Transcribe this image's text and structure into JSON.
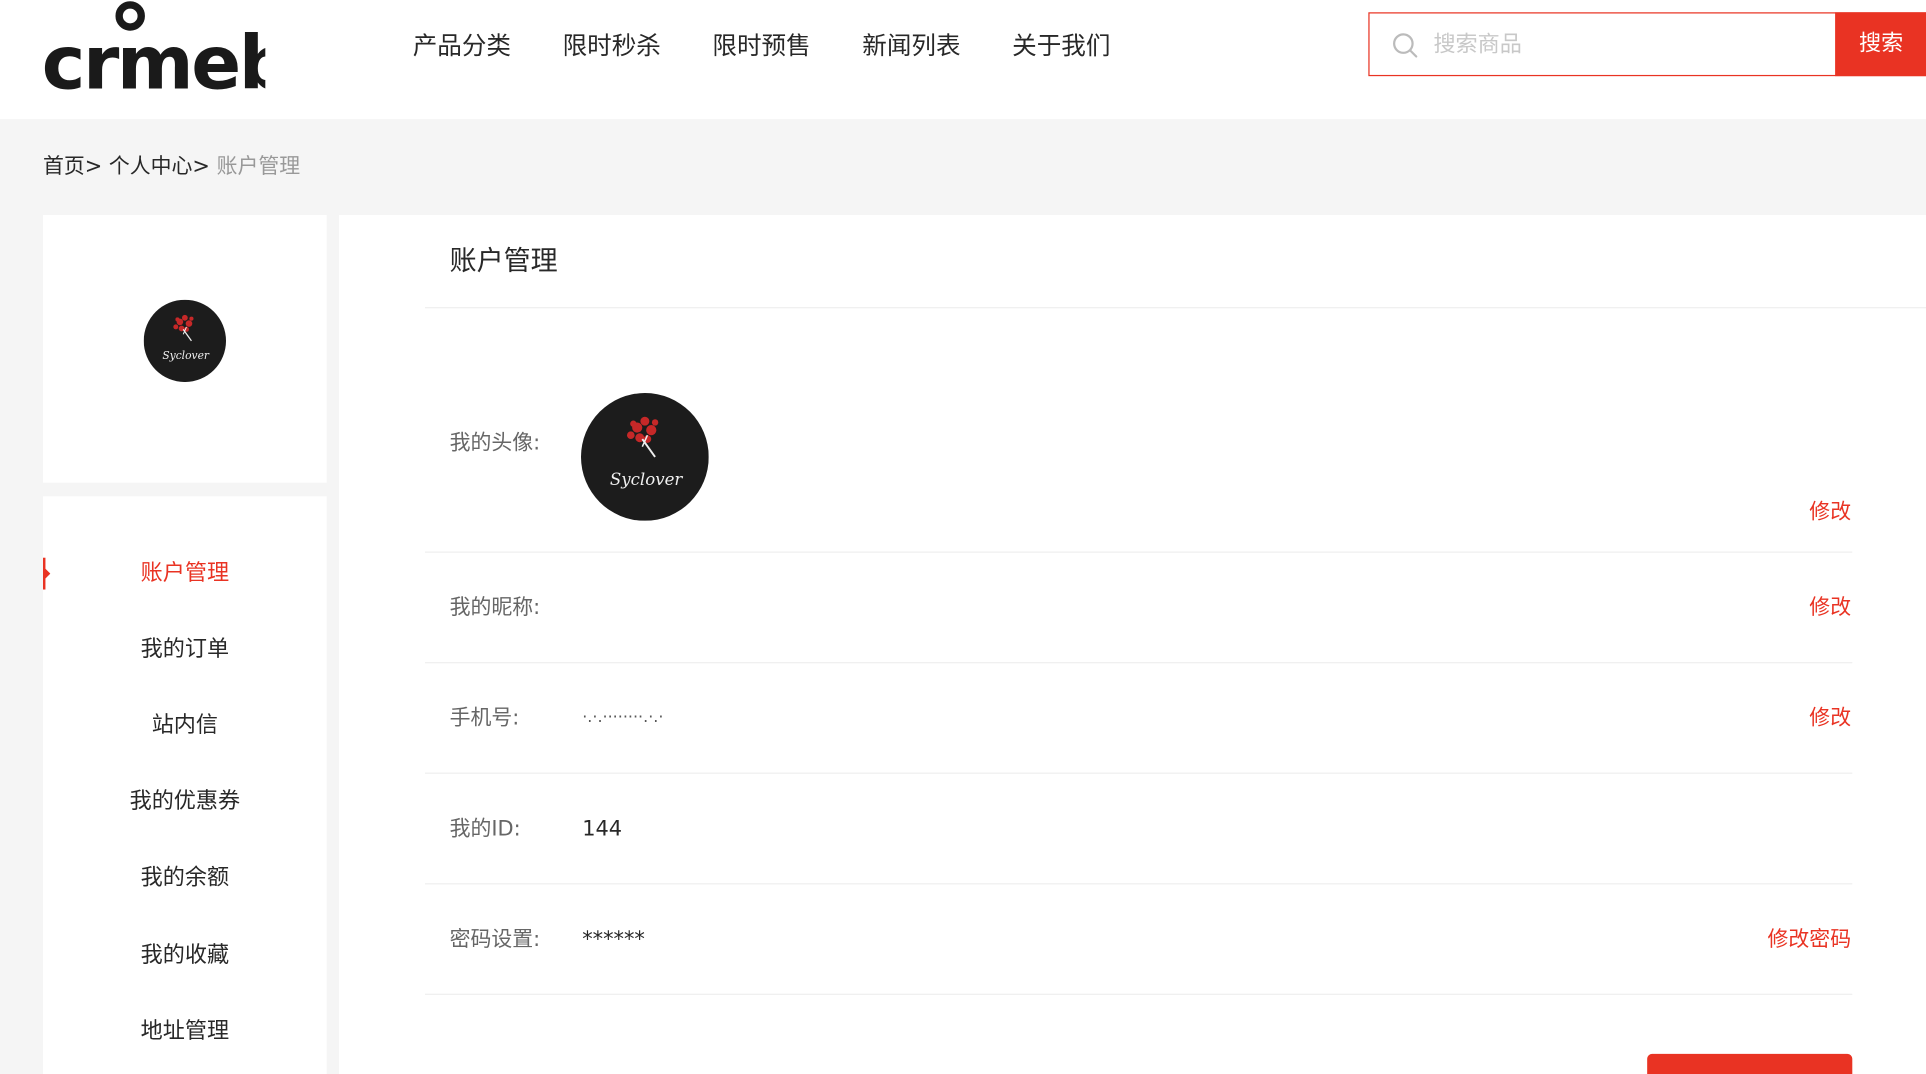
{
  "brand": {
    "logo_text": "crmeb",
    "accent_color": "#e93323"
  },
  "nav": {
    "items": [
      {
        "label": "产品分类"
      },
      {
        "label": "限时秒杀"
      },
      {
        "label": "限时预售"
      },
      {
        "label": "新闻列表"
      },
      {
        "label": "关于我们"
      }
    ]
  },
  "search": {
    "placeholder": "搜索商品",
    "button_label": "搜索",
    "icon": "search-icon"
  },
  "breadcrumb": {
    "items": [
      {
        "label": "首页>"
      },
      {
        "label": "个人中心>"
      },
      {
        "label": "账户管理"
      }
    ]
  },
  "profile": {
    "avatar_text": "Syclover"
  },
  "sidebar": {
    "items": [
      {
        "label": "账户管理",
        "active": true
      },
      {
        "label": "我的订单"
      },
      {
        "label": "站内信"
      },
      {
        "label": "我的优惠券"
      },
      {
        "label": "我的余额"
      },
      {
        "label": "我的收藏"
      },
      {
        "label": "地址管理"
      }
    ]
  },
  "account": {
    "title": "账户管理",
    "rows": {
      "avatar": {
        "label": "我的头像:",
        "action": "修改"
      },
      "nickname": {
        "label": "我的昵称:",
        "value": "",
        "action": "修改"
      },
      "phone": {
        "label": "手机号:",
        "value": "·.·.········.·.·",
        "action": "修改"
      },
      "id": {
        "label": "我的ID:",
        "value": "144"
      },
      "password": {
        "label": "密码设置:",
        "value": "******",
        "action": "修改密码"
      }
    }
  }
}
